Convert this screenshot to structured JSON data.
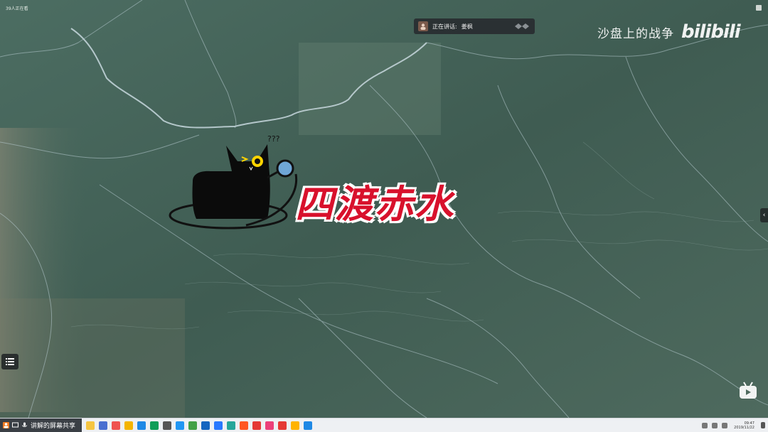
{
  "meeting": {
    "viewers_label": "39人正在看",
    "speaking_label": "正在讲话:",
    "speaker_name": "姜枫"
  },
  "watermark": {
    "channel_name": "沙盘上的战争",
    "logo_text": "bilibili"
  },
  "overlay": {
    "title": "四渡赤水",
    "question_marks": "???"
  },
  "taskbar": {
    "share_label": "讲解的屏幕共享",
    "time": "09:47",
    "date": "2019/11/22",
    "colors": [
      "#4a6fd0",
      "#ef5350",
      "#f4b400",
      "#1e88e5",
      "#0f9d58",
      "#555555",
      "#2196f3",
      "#43a047",
      "#1565c0",
      "#2979ff",
      "#26a69a",
      "#ff5722",
      "#e53935",
      "#ec407a",
      "#e53935",
      "#ffb300",
      "#1e88e5"
    ]
  }
}
